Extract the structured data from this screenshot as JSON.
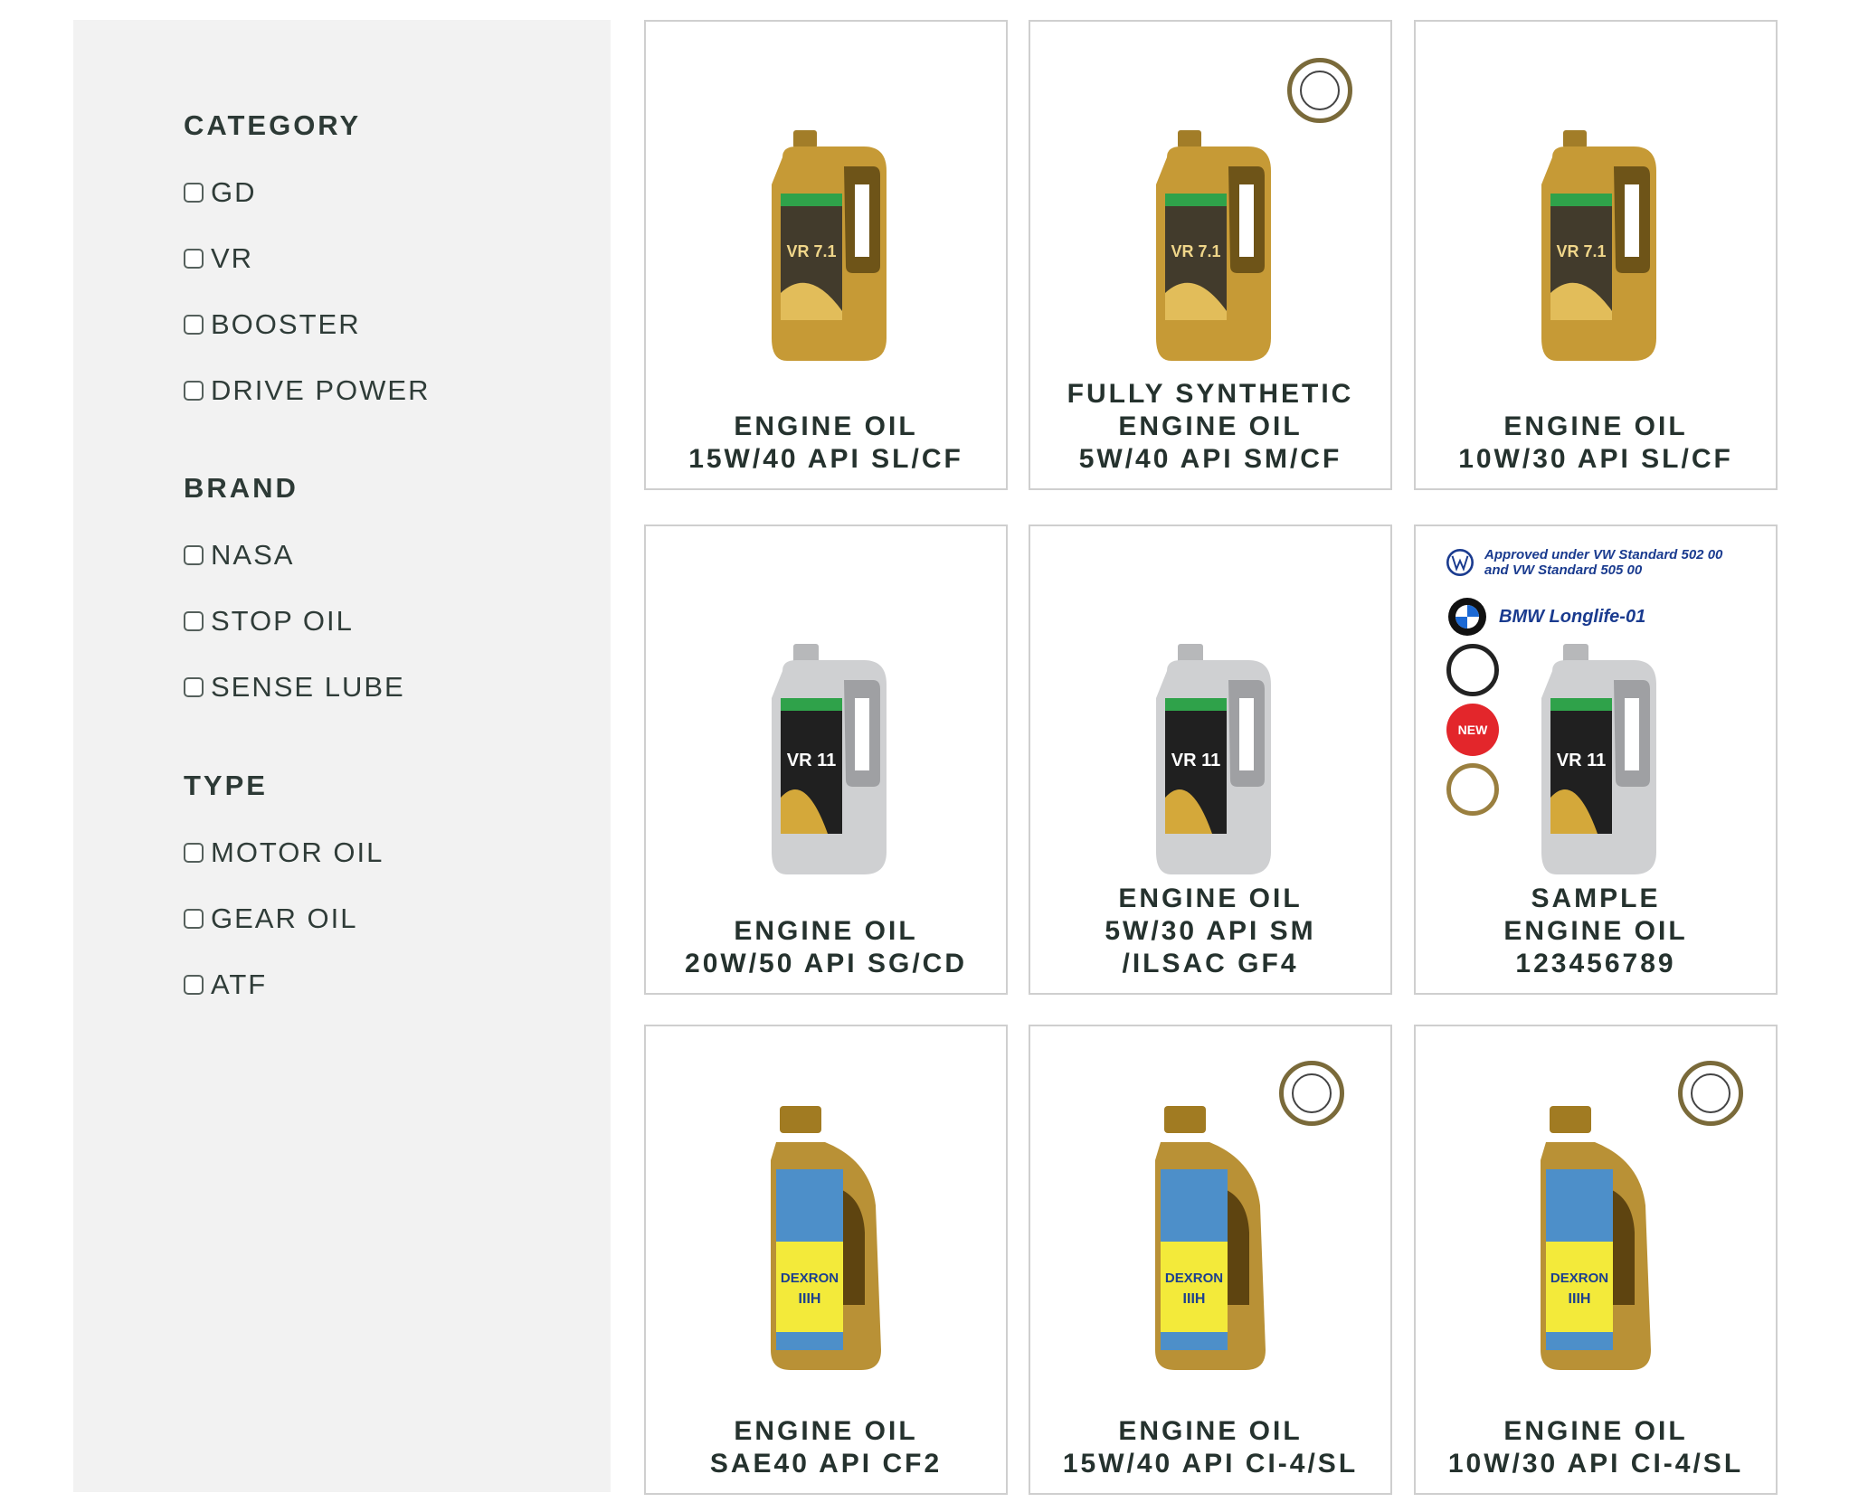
{
  "filters": {
    "category": {
      "heading": "CATEGORY",
      "options": [
        "GD",
        "VR",
        "BOOSTER",
        "DRIVE POWER"
      ]
    },
    "brand": {
      "heading": "BRAND",
      "options": [
        "NASA",
        "STOP OIL",
        "SENSE LUBE"
      ]
    },
    "type": {
      "heading": "TYPE",
      "options": [
        "MOTOR OIL",
        "GEAR OIL",
        "ATF"
      ]
    }
  },
  "products": [
    {
      "title_lines": [
        "ENGINE OIL",
        "15W/40 API SL/CF"
      ],
      "image": "gold-4l-jug-vr71",
      "badge": null
    },
    {
      "title_lines": [
        "FULLY SYNTHETIC",
        "ENGINE OIL",
        "5W/40 API SM/CF"
      ],
      "image": "gold-4l-jug-vr71",
      "badge": "quality-seal"
    },
    {
      "title_lines": [
        "ENGINE OIL",
        "10W/30 API SL/CF"
      ],
      "image": "gold-4l-jug-vr71",
      "badge": null
    },
    {
      "title_lines": [
        "ENGINE OIL",
        "20W/50 API SG/CD"
      ],
      "image": "silver-4l-jug-vr11",
      "badge": null
    },
    {
      "title_lines": [
        "ENGINE OIL",
        "5W/30 API SM",
        "/ILSAC GF4"
      ],
      "image": "silver-4l-jug-vr11",
      "badge": null
    },
    {
      "title_lines": [
        "SAMPLE",
        "ENGINE OIL",
        "123456789"
      ],
      "image": "silver-4l-jug-vr11",
      "badge": "approvals",
      "approvals": {
        "vw_text": "Approved under VW Standard 502 00 and VW Standard 505 00",
        "bmw_text": "BMW Longlife-01",
        "new_label": "NEW"
      }
    },
    {
      "title_lines": [
        "ENGINE OIL",
        "SAE40 API CF2"
      ],
      "image": "gold-1l-bottle-dexron",
      "badge": null
    },
    {
      "title_lines": [
        "ENGINE OIL",
        "15W/40 API CI-4/SL"
      ],
      "image": "gold-1l-bottle-dexron",
      "badge": "quality-seal"
    },
    {
      "title_lines": [
        "ENGINE OIL",
        "10W/30 API CI-4/SL"
      ],
      "image": "gold-1l-bottle-dexron",
      "badge": "quality-seal"
    }
  ],
  "colors": {
    "sidebar_bg": "#f2f2f2",
    "text": "#25322e",
    "card_border": "#cfcfcf",
    "gold": "#b8912f",
    "silver": "#c9cacc"
  }
}
